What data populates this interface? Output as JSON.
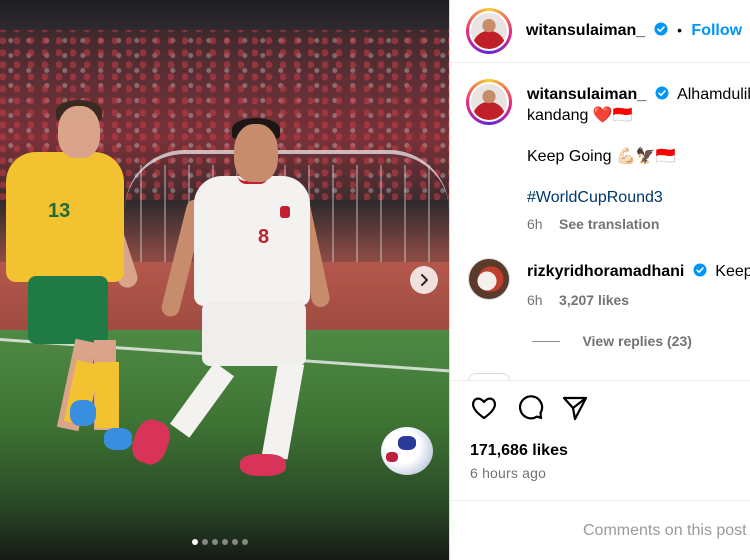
{
  "post": {
    "author": "witansulaiman_",
    "follow_label": "Follow",
    "separator": "•",
    "caption_line1": "Alhamdulill",
    "caption_line2": "kandang ❤️🇮🇩",
    "caption_line3": "Keep Going 💪🏻🦅🇮🇩",
    "hashtag": "#WorldCupRound3",
    "caption_time": "6h",
    "see_translation": "See translation",
    "likes": "171,686 likes",
    "posted_ago": "6 hours ago",
    "comments_placeholder": "Comments on this post"
  },
  "comments": [
    {
      "user": "rizkyridhoramadhani",
      "text_fragment": "Keep",
      "time": "6h",
      "likes": "3,207 likes",
      "view_replies": "View replies (23)"
    }
  ],
  "carousel": {
    "slide_count": 6,
    "active_index": 0
  },
  "colors": {
    "accent": "#0095f6",
    "hashtag": "#00376b",
    "muted": "#737373",
    "verified": "#0095f6"
  },
  "icons": [
    "verified-badge-icon",
    "chevron-right-icon",
    "heart-icon",
    "comment-icon",
    "share-icon"
  ]
}
